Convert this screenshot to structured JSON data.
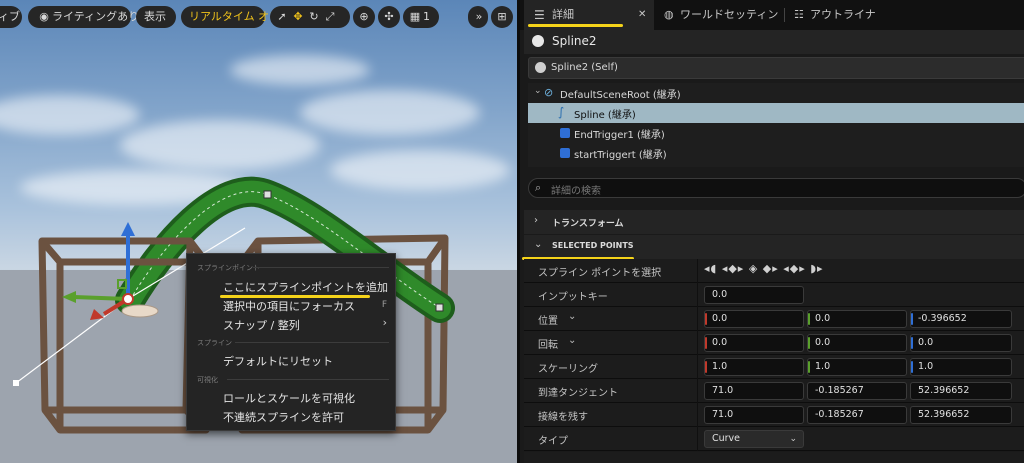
{
  "viewport": {
    "toolbar": {
      "mode_label": "ィブ",
      "lighting_label": "ライティングあり",
      "show_label": "表示",
      "realtime_label": "リアルタイム オフ",
      "grid_value": "1",
      "more_icon": "»"
    }
  },
  "context_menu": {
    "section_spline_points": "スプラインポイント",
    "add_point": "ここにスプラインポイントを追加",
    "focus_selected": "選択中の項目にフォーカス",
    "focus_shortcut": "F",
    "snap_align": "スナップ / 整列",
    "section_spline": "スプライン",
    "reset_default": "デフォルトにリセット",
    "section_visualize": "可視化",
    "visualize_roll_scale": "ロールとスケールを可視化",
    "allow_discontinuous": "不連続スプラインを許可"
  },
  "panel": {
    "tabs": [
      {
        "label": "詳細"
      },
      {
        "label": "ワールドセッティン"
      },
      {
        "label": "アウトライナ"
      }
    ],
    "close_icon": "✕",
    "actor_name": "Spline2",
    "self_label": "Spline2 (Self)",
    "components": [
      {
        "label": "DefaultSceneRoot (継承)"
      },
      {
        "label": "Spline (継承)"
      },
      {
        "label": "EndTrigger1 (継承)"
      },
      {
        "label": "startTriggert (継承)"
      }
    ],
    "search_placeholder": "詳細の検索",
    "sections": {
      "transform": "トランスフォーム",
      "selected_points": "SELECTED POINTS"
    },
    "rows": {
      "select_points": "スプライン ポイントを選択",
      "input_key": "インプットキー",
      "input_key_value": "0.0",
      "location": "位置",
      "location_values": [
        "0.0",
        "0.0",
        "-0.396652"
      ],
      "rotation": "回転",
      "rotation_values": [
        "0.0",
        "0.0",
        "0.0"
      ],
      "scale": "スケーリング",
      "scale_values": [
        "1.0",
        "1.0",
        "1.0"
      ],
      "arrive_tangent": "到達タンジェント",
      "arrive_tangent_values": [
        "71.0",
        "-0.185267",
        "52.396652"
      ],
      "leave_tangent": "接線を残す",
      "leave_tangent_values": [
        "71.0",
        "-0.185267",
        "52.396652"
      ],
      "type": "タイプ",
      "type_value": "Curve"
    }
  },
  "colors": {
    "accent_yellow": "#f5d31a",
    "axis_x": "#c0392b",
    "axis_y": "#5aa02c",
    "axis_z": "#2f6fd6",
    "selection": "#9fb8c4"
  }
}
